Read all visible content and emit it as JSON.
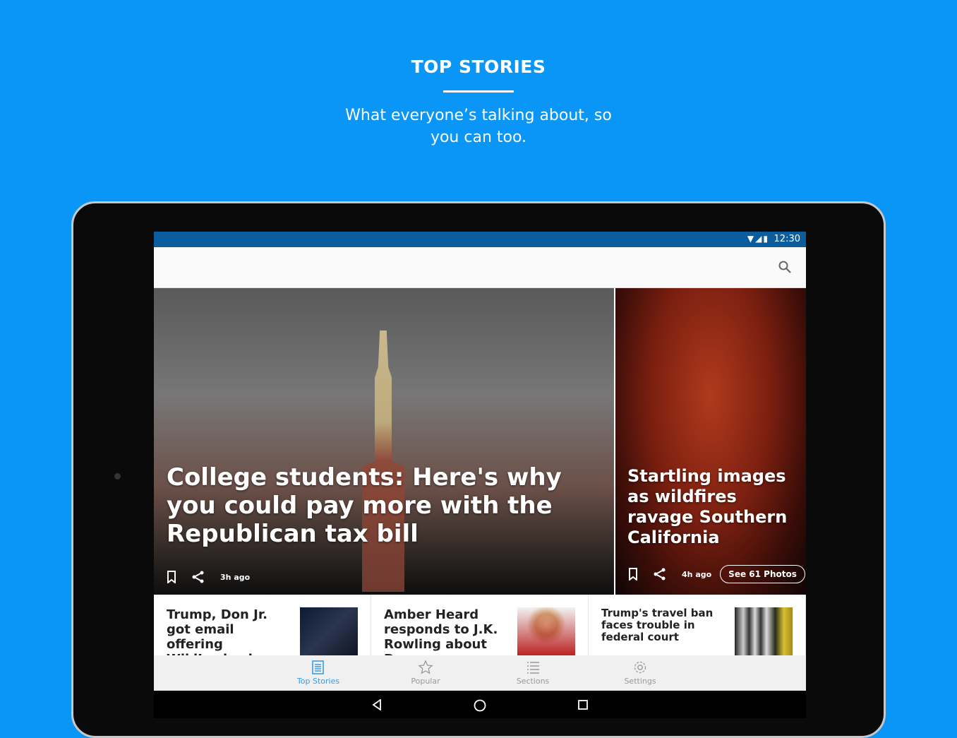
{
  "promo": {
    "title": "TOP STORIES",
    "subtitle": "What everyone’s talking about, so you can too."
  },
  "status": {
    "time": "12:30",
    "icons": [
      "wifi-icon",
      "signal-icon",
      "battery-icon"
    ]
  },
  "hero": [
    {
      "headline": "College students: Here's why you could pay more with the Republican tax bill",
      "age": "3h ago"
    },
    {
      "headline": "Startling images as wildfires ravage Southern California",
      "age": "4h ago",
      "photos_button": "See 61 Photos"
    }
  ],
  "cards": [
    {
      "headline": "Trump, Don Jr. got email offering WikiLeaks docs"
    },
    {
      "headline": "Amber Heard responds to J.K. Rowling about Depp"
    },
    {
      "headline": "Trump's travel ban faces trouble in federal court"
    }
  ],
  "nav": [
    {
      "label": "Top Stories",
      "icon": "newspaper-icon",
      "active": true
    },
    {
      "label": "Popular",
      "icon": "star-icon"
    },
    {
      "label": "Sections",
      "icon": "list-icon"
    },
    {
      "label": "Settings",
      "icon": "gear-icon"
    }
  ],
  "colors": {
    "background": "#0a96f6",
    "status_bar": "#0b5d9e",
    "active_nav": "#3a9be8"
  }
}
